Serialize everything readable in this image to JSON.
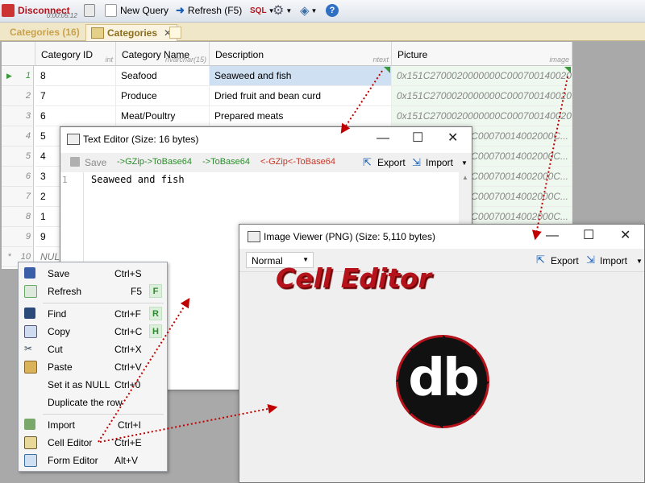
{
  "toolbar": {
    "disconnect_label": "Disconnect",
    "timer": "0:00:05:12",
    "new_query_label": "New Query",
    "refresh_label": "Refresh (F5)",
    "sql_label": "SQL"
  },
  "tabs": [
    {
      "label": "Categories (16)"
    },
    {
      "label": "Categories"
    }
  ],
  "grid": {
    "columns": [
      {
        "label": "Category ID",
        "type": "int"
      },
      {
        "label": "Category Name",
        "type": "nvarchar(15)"
      },
      {
        "label": "Description",
        "type": "ntext"
      },
      {
        "label": "Picture",
        "type": "image"
      }
    ],
    "rows": [
      {
        "rownum": "1",
        "id": "8",
        "name": "Seafood",
        "desc": "Seaweed and fish",
        "pic": "0x151C2700020000000C00070014002000C..."
      },
      {
        "rownum": "2",
        "id": "7",
        "name": "Produce",
        "desc": "Dried fruit and bean curd",
        "pic": "0x151C2700020000000C00070014002000C..."
      },
      {
        "rownum": "3",
        "id": "6",
        "name": "Meat/Poultry",
        "desc": "Prepared meats",
        "pic": "0x151C2700020000000C00070014002000C..."
      },
      {
        "rownum": "4",
        "id": "5",
        "name": "",
        "desc": "",
        "pic": "00C00070014002000C..."
      },
      {
        "rownum": "5",
        "id": "4",
        "name": "",
        "desc": "",
        "pic": "00C00070014002000C..."
      },
      {
        "rownum": "6",
        "id": "3",
        "name": "",
        "desc": "",
        "pic": "00C00070014002000C..."
      },
      {
        "rownum": "7",
        "id": "2",
        "name": "",
        "desc": "",
        "pic": "00C00070014002000C..."
      },
      {
        "rownum": "8",
        "id": "1",
        "name": "",
        "desc": "",
        "pic": "00C00070014002000C..."
      },
      {
        "rownum": "9",
        "id": "9",
        "name": "",
        "desc": "",
        "pic": ""
      },
      {
        "rownum": "10",
        "id": "NULL",
        "name": "",
        "desc": "",
        "pic": ""
      }
    ]
  },
  "text_editor": {
    "title": "Text Editor (Size: 16 bytes)",
    "save_label": "Save",
    "transforms": [
      "->GZip->ToBase64",
      "->ToBase64",
      "<-GZip<-ToBase64"
    ],
    "export_label": "Export",
    "import_label": "Import",
    "line_number": "1",
    "content": "Seaweed and fish"
  },
  "image_viewer": {
    "title": "Image Viewer (PNG) (Size: 5,110 bytes)",
    "zoom_option": "Normal",
    "export_label": "Export",
    "import_label": "Import",
    "logo_text": "db"
  },
  "annotation": "Cell Editor",
  "context_menu": {
    "items": [
      {
        "label": "Save",
        "shortcut": "Ctrl+S",
        "hotkey": ""
      },
      {
        "label": "Refresh",
        "shortcut": "F5",
        "hotkey": "F"
      },
      {
        "label": "Find",
        "shortcut": "Ctrl+F",
        "hotkey": "R"
      },
      {
        "label": "Copy",
        "shortcut": "Ctrl+C",
        "hotkey": "H"
      },
      {
        "label": "Cut",
        "shortcut": "Ctrl+X",
        "hotkey": ""
      },
      {
        "label": "Paste",
        "shortcut": "Ctrl+V",
        "hotkey": ""
      },
      {
        "label": "Set it as NULL",
        "shortcut": "Ctrl+0",
        "hotkey": ""
      },
      {
        "label": "Duplicate the row",
        "shortcut": "",
        "hotkey": ""
      },
      {
        "label": "Import",
        "shortcut": "Ctrl+I",
        "hotkey": ""
      },
      {
        "label": "Cell Editor",
        "shortcut": "Ctrl+E",
        "hotkey": ""
      },
      {
        "label": "Form Editor",
        "shortcut": "Alt+V",
        "hotkey": ""
      }
    ]
  },
  "colors": {
    "accent_red": "#b5121b",
    "arrow_red": "#c00000",
    "selected_cell": "#cfe0f2",
    "hotkey_green": "#2d8a2d"
  }
}
